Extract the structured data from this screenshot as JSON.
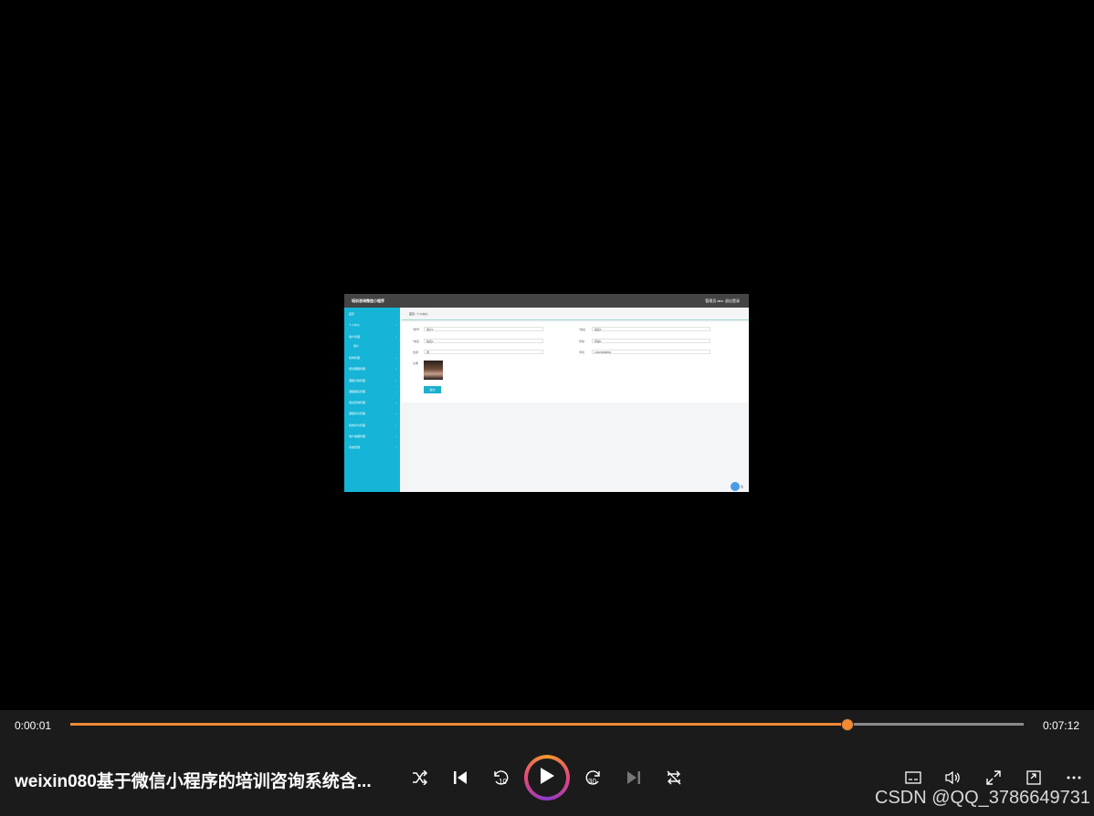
{
  "video_frame": {
    "app_title": "培训咨询微信小程序",
    "admin_label": "管理员 abo",
    "logout_label": "退出登录",
    "sidebar": [
      {
        "label": "首页",
        "arrow": ""
      },
      {
        "label": "个人中心",
        "arrow": "›"
      },
      {
        "label": "用户管理",
        "arrow": "›"
      },
      {
        "label": "用户",
        "arrow": ""
      },
      {
        "label": "机构管理",
        "arrow": "›"
      },
      {
        "label": "培训课程管理",
        "arrow": "›"
      },
      {
        "label": "课程分类管理",
        "arrow": "›"
      },
      {
        "label": "课程报名管理",
        "arrow": "›"
      },
      {
        "label": "培训咨询管理",
        "arrow": "›"
      },
      {
        "label": "课程评价管理",
        "arrow": "›"
      },
      {
        "label": "机构评价管理",
        "arrow": "›"
      },
      {
        "label": "用户收藏管理",
        "arrow": "›"
      },
      {
        "label": "系统管理",
        "arrow": "›"
      }
    ],
    "breadcrumb": "首页 / 个人中心",
    "form": {
      "fields": [
        {
          "label": "*账号",
          "value": "用户1"
        },
        {
          "label": "*姓名",
          "value": "姓名1"
        },
        {
          "label": "*姓名",
          "value": "姓名1"
        },
        {
          "label": "年龄",
          "value": "年龄1"
        },
        {
          "label": "性别",
          "value": "男"
        },
        {
          "label": "手机",
          "value": "13823888881"
        }
      ],
      "avatar_label": "头像",
      "save_label": "提交"
    },
    "bubble_text": "注"
  },
  "player": {
    "current_time": "0:00:01",
    "duration": "0:07:12",
    "progress_fraction": 0.815,
    "title": "weixin080基于微信小程序的培训咨询系统含...",
    "watermark": "CSDN @QQ_3786649731",
    "colors": {
      "accent": "#f08a34",
      "bar_bg": "#1b1b1b"
    }
  }
}
